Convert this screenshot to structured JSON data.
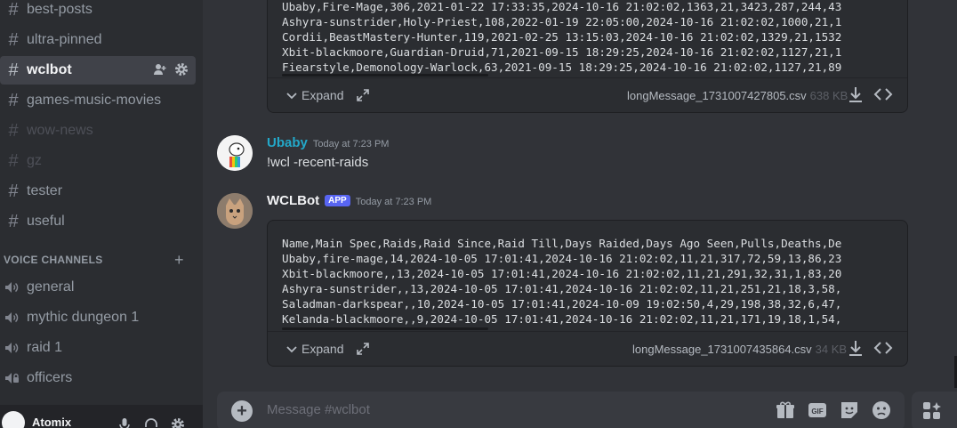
{
  "sidebar": {
    "channels": [
      {
        "name": "best-posts"
      },
      {
        "name": "ultra-pinned"
      },
      {
        "name": "wclbot"
      },
      {
        "name": "games-music-movies"
      },
      {
        "name": "wow-news"
      },
      {
        "name": "gz"
      },
      {
        "name": "tester"
      },
      {
        "name": "useful"
      }
    ],
    "voice_section": "VOICE CHANNELS",
    "voice_channels": [
      {
        "name": "general"
      },
      {
        "name": "mythic dungeon 1"
      },
      {
        "name": "raid 1"
      },
      {
        "name": "officers"
      }
    ],
    "user": {
      "name": "Atomix"
    }
  },
  "attachments": [
    {
      "lines": [
        "Ubaby,Fire-Mage,306,2021-01-22 17:33:35,2024-10-16 21:02:02,1363,21,3423,287,244,43",
        "Ashyra-sunstrider,Holy-Priest,108,2022-01-19 22:05:00,2024-10-16 21:02:02,1000,21,1",
        "Cordii,BeastMastery-Hunter,119,2021-02-25 13:15:03,2024-10-16 21:02:02,1329,21,1532",
        "Xbit-blackmoore,Guardian-Druid,71,2021-09-15 18:29:25,2024-10-16 21:02:02,1127,21,1",
        "Fiearstyle,Demonology-Warlock,63,2021-09-15 18:29:25,2024-10-16 21:02:02,1127,21,89"
      ],
      "expand_label": "Expand",
      "filename": "longMessage_1731007427805.csv",
      "filesize": "638 KB"
    },
    {
      "lines": [
        "Name,Main Spec,Raids,Raid Since,Raid Till,Days Raided,Days Ago Seen,Pulls,Deaths,De",
        "Ubaby,fire-mage,14,2024-10-05 17:01:41,2024-10-16 21:02:02,11,21,317,72,59,13,86,23",
        "Xbit-blackmoore,,13,2024-10-05 17:01:41,2024-10-16 21:02:02,11,21,291,32,31,1,83,20",
        "Ashyra-sunstrider,,13,2024-10-05 17:01:41,2024-10-16 21:02:02,11,21,251,21,18,3,58,",
        "Saladman-darkspear,,10,2024-10-05 17:01:41,2024-10-09 19:02:50,4,29,198,38,32,6,47,",
        "Kelanda-blackmoore,,9,2024-10-05 17:01:41,2024-10-16 21:02:02,11,21,171,19,18,1,54,"
      ],
      "expand_label": "Expand",
      "filename": "longMessage_1731007435864.csv",
      "filesize": "34 KB"
    }
  ],
  "messages": [
    {
      "author": "Ubaby",
      "author_color": "#23a8c9",
      "timestamp": "Today at 7:23 PM",
      "text": "!wcl -recent-raids"
    },
    {
      "author": "WCLBot",
      "author_color": "#f2f3f5",
      "badge": "APP",
      "timestamp": "Today at 7:23 PM"
    }
  ],
  "composer": {
    "placeholder": "Message #wclbot"
  },
  "icons": {
    "add_member": "add-member-icon",
    "settings": "gear-icon",
    "download": "download-icon",
    "code": "code-icon",
    "gift": "gift-icon",
    "gif": "GIF",
    "sticker": "sticker-icon",
    "emoji": "emoji-icon",
    "apps": "apps-icon"
  }
}
